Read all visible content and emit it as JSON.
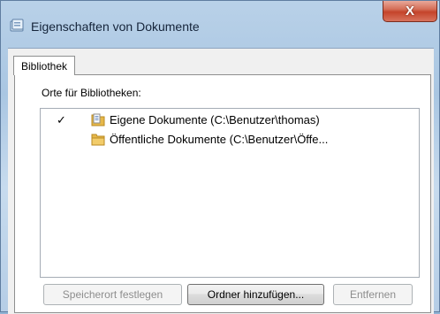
{
  "window": {
    "title": "Eigenschaften von Dokumente"
  },
  "titlebar": {
    "close_glyph": "X"
  },
  "tabs": [
    {
      "label": "Bibliothek"
    }
  ],
  "library": {
    "section_label": "Orte für Bibliotheken:",
    "items": [
      {
        "checked": true,
        "check_glyph": "✓",
        "icon": "library-doc-icon",
        "label": "Eigene Dokumente (C:\\Benutzer\\thomas)"
      },
      {
        "checked": false,
        "check_glyph": "",
        "icon": "folder-icon",
        "label": "Öffentliche Dokumente (C:\\Benutzer\\Öffe..."
      }
    ]
  },
  "buttons": {
    "set_location": "Speicherort festlegen",
    "add_folder": "Ordner hinzufügen...",
    "remove": "Entfernen"
  },
  "colors": {
    "folder": "#e6b84a",
    "close_red": "#c4432a"
  }
}
